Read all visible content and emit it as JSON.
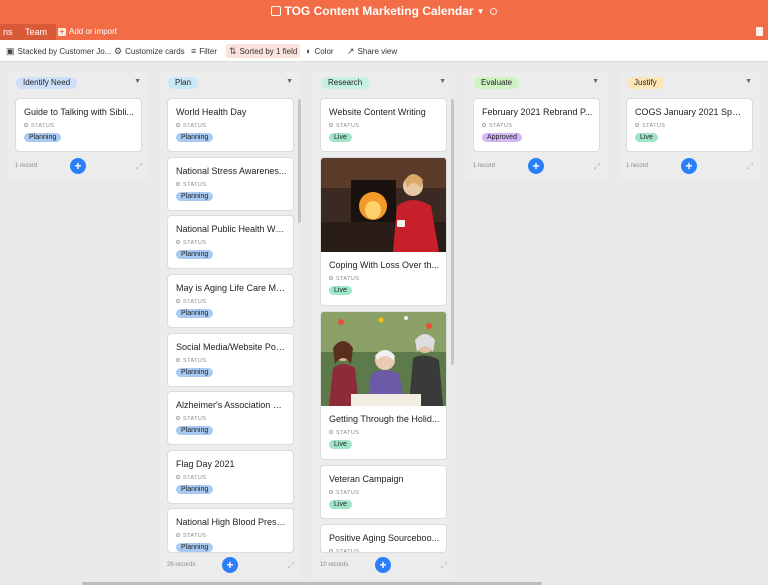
{
  "app": {
    "title": "TOG Content Marketing Calendar",
    "tab_cut_label": "ns",
    "active_tab": "Team",
    "add_import": "Add or import"
  },
  "toolbar": {
    "stacked": "Stacked by Customer Jo...",
    "customize": "Customize cards",
    "filter": "Filter",
    "sorted": "Sorted by 1 field",
    "color": "Color",
    "share": "Share view"
  },
  "colors": {
    "brand": "#f26c45",
    "planning": "#a7c9f2",
    "live": "#9ee6c7",
    "approved": "#d2b7f5",
    "add_button": "#2d7ff9"
  },
  "status_label": "STATUS",
  "columns": [
    {
      "name": "Identify Need",
      "color": "#cfe0fb",
      "records": "1 record",
      "cards": [
        {
          "title": "Guide to Talking with Sibli...",
          "status": "Planning"
        }
      ]
    },
    {
      "name": "Plan",
      "color": "#c9e9f7",
      "records": "26 records",
      "cards": [
        {
          "title": "World Health Day",
          "status": "Planning"
        },
        {
          "title": "National Stress Awarenes...",
          "status": "Planning"
        },
        {
          "title": "National Public Health We...",
          "status": "Planning"
        },
        {
          "title": "May is Aging Life Care Mo...",
          "status": "Planning"
        },
        {
          "title": "Social Media/Website Pos...",
          "status": "Planning"
        },
        {
          "title": "Alzheimer's Association Vi...",
          "status": "Planning"
        },
        {
          "title": "Flag Day 2021",
          "status": "Planning"
        },
        {
          "title": "National High Blood Press...",
          "status": "Planning"
        }
      ]
    },
    {
      "name": "Research",
      "color": "#c6f0df",
      "records": "10 records",
      "cards": [
        {
          "title": "Website Content Writing",
          "status": "Live"
        },
        {
          "title": "Coping With Loss Over th...",
          "status": "Live"
        },
        {
          "title": "Getting Through the Holid...",
          "status": "Live"
        },
        {
          "title": "Veteran Campaign",
          "status": "Live"
        },
        {
          "title": "Positive Aging Sourceboo...",
          "status": ""
        }
      ]
    },
    {
      "name": "Evaluate",
      "color": "#cdf3c3",
      "records": "1 record",
      "cards": [
        {
          "title": "February 2021 Rebrand P...",
          "status": "Approved"
        }
      ]
    },
    {
      "name": "Justify",
      "color": "#fde5b7",
      "records": "1 record",
      "cards": [
        {
          "title": "COGS January 2021 Spon...",
          "status": "Live"
        }
      ]
    }
  ]
}
